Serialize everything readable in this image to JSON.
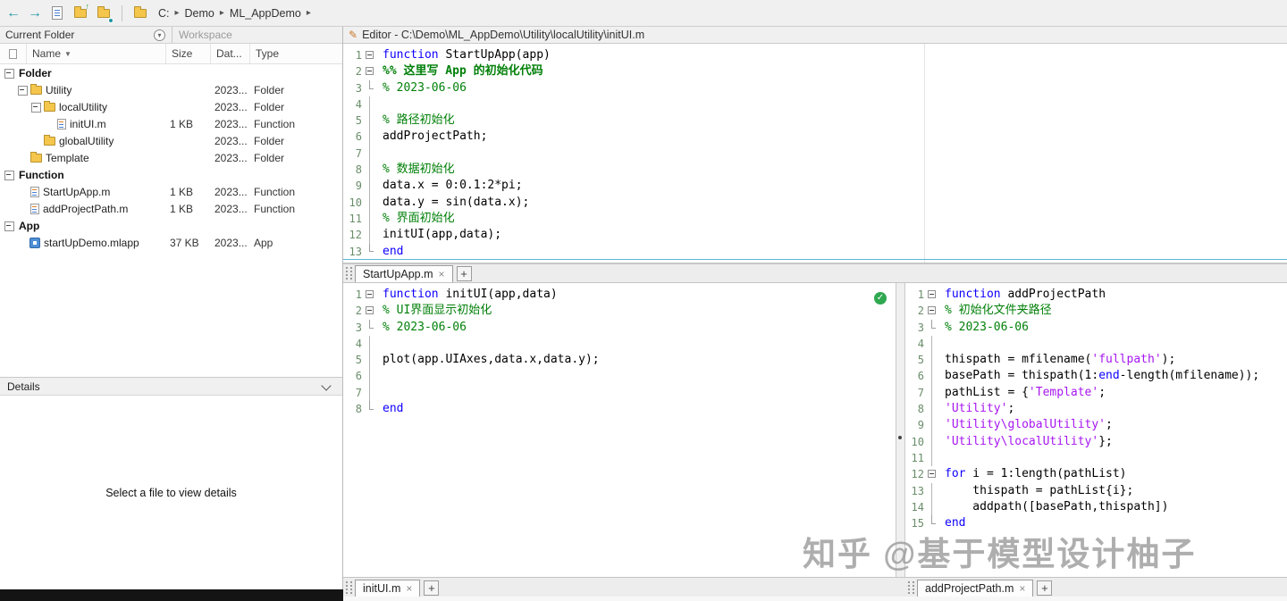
{
  "toolbar": {
    "back": "←",
    "forward": "→",
    "breadcrumb": [
      "C:",
      "Demo",
      "ML_AppDemo"
    ]
  },
  "current_folder": {
    "title": "Current Folder",
    "workspace": "Workspace",
    "columns": {
      "name": "Name",
      "size": "Size",
      "date": "Dat...",
      "type": "Type"
    },
    "rows": [
      {
        "name": "Folder",
        "level": 0,
        "bold": true,
        "expander": true,
        "icon": "",
        "size": "",
        "date": "",
        "type": ""
      },
      {
        "name": "Utility",
        "level": 1,
        "bold": false,
        "expander": true,
        "icon": "folder",
        "size": "",
        "date": "2023...",
        "type": "Folder"
      },
      {
        "name": "localUtility",
        "level": 2,
        "bold": false,
        "expander": true,
        "icon": "folder",
        "size": "",
        "date": "2023...",
        "type": "Folder"
      },
      {
        "name": "initUI.m",
        "level": 3,
        "bold": false,
        "expander": false,
        "icon": "mfile",
        "size": "1 KB",
        "date": "2023...",
        "type": "Function"
      },
      {
        "name": "globalUtility",
        "level": 2,
        "bold": false,
        "expander": false,
        "icon": "folder",
        "size": "",
        "date": "2023...",
        "type": "Folder"
      },
      {
        "name": "Template",
        "level": 1,
        "bold": false,
        "expander": false,
        "icon": "folder",
        "size": "",
        "date": "2023...",
        "type": "Folder"
      },
      {
        "name": "Function",
        "level": 0,
        "bold": true,
        "expander": true,
        "icon": "",
        "size": "",
        "date": "",
        "type": ""
      },
      {
        "name": "StartUpApp.m",
        "level": 1,
        "bold": false,
        "expander": false,
        "icon": "mfile",
        "size": "1 KB",
        "date": "2023...",
        "type": "Function"
      },
      {
        "name": "addProjectPath.m",
        "level": 1,
        "bold": false,
        "expander": false,
        "icon": "mfile",
        "size": "1 KB",
        "date": "2023...",
        "type": "Function"
      },
      {
        "name": "App",
        "level": 0,
        "bold": true,
        "expander": true,
        "icon": "",
        "size": "",
        "date": "",
        "type": ""
      },
      {
        "name": "startUpDemo.mlapp",
        "level": 1,
        "bold": false,
        "expander": false,
        "icon": "app",
        "size": "37 KB",
        "date": "2023...",
        "type": "App"
      }
    ],
    "details": {
      "title": "Details",
      "empty_message": "Select a file to view details"
    }
  },
  "editor": {
    "title": "Editor - C:\\Demo\\ML_AppDemo\\Utility\\localUtility\\initUI.m",
    "panes": {
      "top": {
        "tab": {
          "label": "StartUpApp.m",
          "close": "×",
          "add": "+"
        },
        "lines": [
          {
            "n": 1,
            "fold": "box",
            "segs": [
              [
                "kw",
                "function"
              ],
              [
                "pl",
                " StartUpApp(app)"
              ]
            ]
          },
          {
            "n": 2,
            "fold": "box",
            "segs": [
              [
                "sec",
                "%% 这里写 App 的初始化代码"
              ]
            ]
          },
          {
            "n": 3,
            "fold": "end",
            "segs": [
              [
                "cm",
                "% 2023-06-06"
              ]
            ]
          },
          {
            "n": 4,
            "fold": "line",
            "segs": []
          },
          {
            "n": 5,
            "fold": "line",
            "segs": [
              [
                "cm",
                "% 路径初始化"
              ]
            ]
          },
          {
            "n": 6,
            "fold": "line",
            "segs": [
              [
                "pl",
                "addProjectPath;"
              ]
            ]
          },
          {
            "n": 7,
            "fold": "line",
            "segs": []
          },
          {
            "n": 8,
            "fold": "line",
            "segs": [
              [
                "cm",
                "% 数据初始化"
              ]
            ]
          },
          {
            "n": 9,
            "fold": "line",
            "segs": [
              [
                "pl",
                "data.x = 0:0.1:2*pi;"
              ]
            ]
          },
          {
            "n": 10,
            "fold": "line",
            "segs": [
              [
                "pl",
                "data.y = sin(data.x);"
              ]
            ]
          },
          {
            "n": 11,
            "fold": "line",
            "segs": [
              [
                "cm",
                "% 界面初始化"
              ]
            ]
          },
          {
            "n": 12,
            "fold": "line",
            "segs": [
              [
                "pl",
                "initUI(app,data);"
              ]
            ]
          },
          {
            "n": 13,
            "fold": "end",
            "cur": true,
            "segs": [
              [
                "kw",
                "end"
              ]
            ]
          }
        ]
      },
      "bottom_left": {
        "tab": {
          "label": "initUI.m",
          "close": "×",
          "add": "+"
        },
        "status_icon": "✓",
        "lines": [
          {
            "n": 1,
            "fold": "box",
            "segs": [
              [
                "kw",
                "function"
              ],
              [
                "pl",
                " initUI(app,data)"
              ]
            ]
          },
          {
            "n": 2,
            "fold": "box",
            "segs": [
              [
                "cm",
                "% UI界面显示初始化"
              ]
            ]
          },
          {
            "n": 3,
            "fold": "end",
            "segs": [
              [
                "cm",
                "% 2023-06-06"
              ]
            ]
          },
          {
            "n": 4,
            "fold": "line",
            "segs": []
          },
          {
            "n": 5,
            "fold": "line",
            "segs": [
              [
                "pl",
                "plot(app.UIAxes,data.x,data.y);"
              ]
            ]
          },
          {
            "n": 6,
            "fold": "line",
            "segs": []
          },
          {
            "n": 7,
            "fold": "line",
            "segs": []
          },
          {
            "n": 8,
            "fold": "end",
            "segs": [
              [
                "kw",
                "end"
              ]
            ]
          }
        ]
      },
      "bottom_right": {
        "tab": {
          "label": "addProjectPath.m",
          "close": "×",
          "add": "+"
        },
        "lines": [
          {
            "n": 1,
            "fold": "box",
            "segs": [
              [
                "kw",
                "function"
              ],
              [
                "pl",
                " addProjectPath"
              ]
            ]
          },
          {
            "n": 2,
            "fold": "box",
            "segs": [
              [
                "cm",
                "% 初始化文件夹路径"
              ]
            ]
          },
          {
            "n": 3,
            "fold": "end",
            "segs": [
              [
                "cm",
                "% 2023-06-06"
              ]
            ]
          },
          {
            "n": 4,
            "fold": "line",
            "segs": []
          },
          {
            "n": 5,
            "fold": "line",
            "segs": [
              [
                "pl",
                "thispath = mfilename("
              ],
              [
                "st",
                "'fullpath'"
              ],
              [
                "pl",
                ");"
              ]
            ]
          },
          {
            "n": 6,
            "fold": "line",
            "segs": [
              [
                "pl",
                "basePath = thispath(1:"
              ],
              [
                "kw",
                "end"
              ],
              [
                "pl",
                "-length(mfilename));"
              ]
            ]
          },
          {
            "n": 7,
            "fold": "line",
            "segs": [
              [
                "pl",
                "pathList = {"
              ],
              [
                "st",
                "'Template'"
              ],
              [
                "pl",
                ";"
              ]
            ]
          },
          {
            "n": 8,
            "fold": "line",
            "segs": [
              [
                "st",
                "'Utility'"
              ],
              [
                "pl",
                ";"
              ]
            ]
          },
          {
            "n": 9,
            "fold": "line",
            "segs": [
              [
                "st",
                "'Utility\\globalUtility'"
              ],
              [
                "pl",
                ";"
              ]
            ]
          },
          {
            "n": 10,
            "fold": "line",
            "segs": [
              [
                "st",
                "'Utility\\localUtility'"
              ],
              [
                "pl",
                "};"
              ]
            ]
          },
          {
            "n": 11,
            "fold": "line",
            "segs": []
          },
          {
            "n": 12,
            "fold": "box",
            "segs": [
              [
                "kw",
                "for"
              ],
              [
                "pl",
                " i = 1:length(pathList)"
              ]
            ]
          },
          {
            "n": 13,
            "fold": "line",
            "segs": [
              [
                "pl",
                "    thispath = pathList{i};"
              ]
            ]
          },
          {
            "n": 14,
            "fold": "line",
            "segs": [
              [
                "pl",
                "    addpath([basePath,thispath])"
              ]
            ]
          },
          {
            "n": 15,
            "fold": "end",
            "segs": [
              [
                "kw",
                "end"
              ]
            ]
          }
        ]
      }
    }
  },
  "watermark": "知乎 @基于模型设计柚子",
  "colors": {
    "keyword": "#0e00ff",
    "comment": "#028009",
    "string": "#a616f0",
    "line_number": "#6a8d6a",
    "accent_teal": "#2196a6"
  }
}
